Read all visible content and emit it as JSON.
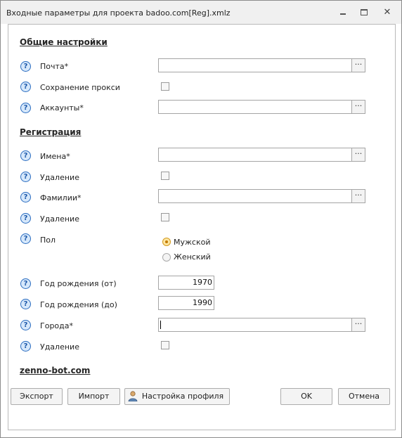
{
  "window": {
    "title": "Входные параметры для проекта badoo.com[Reg].xmlz"
  },
  "sections": {
    "general": "Общие настройки",
    "registration": "Регистрация",
    "footer_link": "zenno-bot.com"
  },
  "fields": {
    "email": {
      "label": "Почта*",
      "value": ""
    },
    "save_proxy": {
      "label": "Сохранение прокси",
      "checked": false
    },
    "accounts": {
      "label": "Аккаунты*",
      "value": ""
    },
    "names": {
      "label": "Имена*",
      "value": ""
    },
    "names_delete": {
      "label": "Удаление",
      "checked": false
    },
    "surnames": {
      "label": "Фамилии*",
      "value": ""
    },
    "surnames_delete": {
      "label": "Удаление",
      "checked": false
    },
    "gender": {
      "label": "Пол",
      "options": [
        "Мужской",
        "Женский"
      ],
      "selected": "Мужской"
    },
    "birth_year_from": {
      "label": "Год рождения (от)",
      "value": "1970"
    },
    "birth_year_to": {
      "label": "Год рождения (до)",
      "value": "1990"
    },
    "cities": {
      "label": "Города*",
      "value": ""
    },
    "cities_delete": {
      "label": "Удаление",
      "checked": false
    }
  },
  "browse_button_label": "···",
  "help_icon_glyph": "?",
  "buttons": {
    "export": "Экспорт",
    "import": "Импорт",
    "profile_settings": "Настройка профиля",
    "ok": "OK",
    "cancel": "Отмена"
  },
  "colors": {
    "help_icon": "#2a6cc0",
    "radio_selected": "#d39a1f"
  }
}
